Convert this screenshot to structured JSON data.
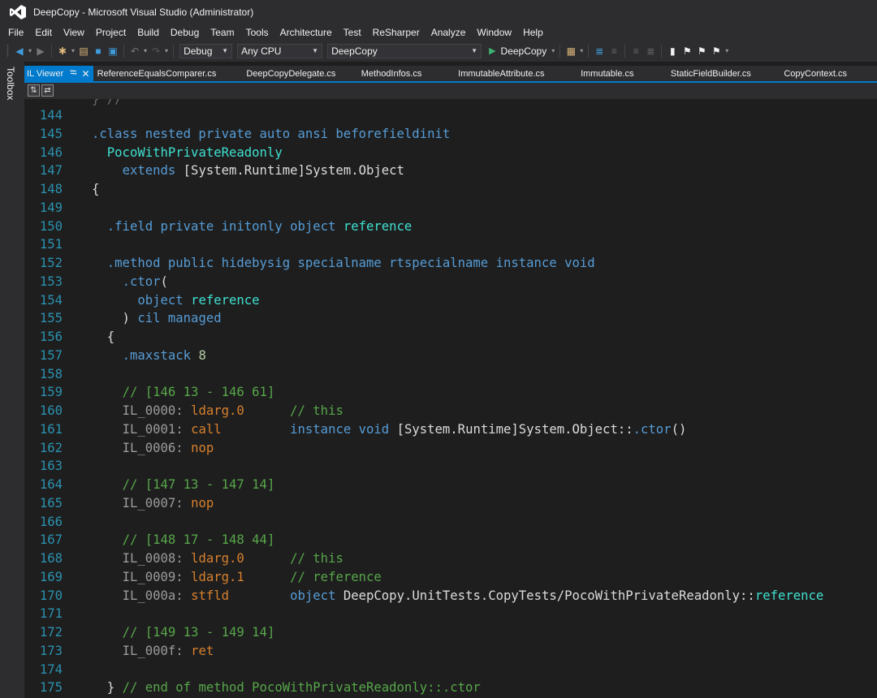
{
  "window": {
    "title": "DeepCopy - Microsoft Visual Studio  (Administrator)",
    "logo_icon": "visual-studio-logo"
  },
  "menu": [
    "File",
    "Edit",
    "View",
    "Project",
    "Build",
    "Debug",
    "Team",
    "Tools",
    "Architecture",
    "Test",
    "ReSharper",
    "Analyze",
    "Window",
    "Help"
  ],
  "toolbar": {
    "configuration": "Debug",
    "platform": "Any CPU",
    "startup_project": "DeepCopy",
    "run_label": "DeepCopy"
  },
  "toolbox_label": "Toolbox",
  "tabs": [
    {
      "label": "IL Viewer",
      "active": true
    },
    {
      "label": "ReferenceEqualsComparer.cs"
    },
    {
      "label": "DeepCopyDelegate.cs"
    },
    {
      "label": "MethodInfos.cs"
    },
    {
      "label": "ImmutableAttribute.cs"
    },
    {
      "label": "Immutable.cs"
    },
    {
      "label": "StaticFieldBuilder.cs"
    },
    {
      "label": "CopyContext.cs"
    }
  ],
  "code": {
    "lines": [
      {
        "n": "144"
      },
      {
        "n": "145",
        "t": ".class nested private auto ansi beforefieldinit"
      },
      {
        "n": "146",
        "t": "PocoWithPrivateReadonly"
      },
      {
        "n": "147",
        "t": "extends [System.Runtime]System.Object"
      },
      {
        "n": "148",
        "t": "{"
      },
      {
        "n": "149"
      },
      {
        "n": "150",
        "t": ".field private initonly object reference"
      },
      {
        "n": "151"
      },
      {
        "n": "152",
        "t": ".method public hidebysig specialname rtspecialname instance void"
      },
      {
        "n": "153",
        "t": ".ctor("
      },
      {
        "n": "154",
        "t": "object reference"
      },
      {
        "n": "155",
        "t": ") cil managed"
      },
      {
        "n": "156",
        "t": "{"
      },
      {
        "n": "157",
        "t": ".maxstack 8"
      },
      {
        "n": "158"
      },
      {
        "n": "159",
        "t": "// [146 13 - 146 61]"
      },
      {
        "n": "160",
        "t": "IL_0000: ldarg.0      // this"
      },
      {
        "n": "161",
        "t": "IL_0001: call         instance void [System.Runtime]System.Object::.ctor()"
      },
      {
        "n": "162",
        "t": "IL_0006: nop"
      },
      {
        "n": "163"
      },
      {
        "n": "164",
        "t": "// [147 13 - 147 14]"
      },
      {
        "n": "165",
        "t": "IL_0007: nop"
      },
      {
        "n": "166"
      },
      {
        "n": "167",
        "t": "// [148 17 - 148 44]"
      },
      {
        "n": "168",
        "t": "IL_0008: ldarg.0      // this"
      },
      {
        "n": "169",
        "t": "IL_0009: ldarg.1      // reference"
      },
      {
        "n": "170",
        "t": "IL_000a: stfld        object DeepCopy.UnitTests.CopyTests/PocoWithPrivateReadonly::reference"
      },
      {
        "n": "171"
      },
      {
        "n": "172",
        "t": "// [149 13 - 149 14]"
      },
      {
        "n": "173",
        "t": "IL_000f: ret"
      },
      {
        "n": "174"
      },
      {
        "n": "175",
        "t": "} // end of method PocoWithPrivateReadonly::.ctor"
      }
    ]
  },
  "colors": {
    "background": "#1e1e1e",
    "chrome": "#2d2d30",
    "accent": "#007acc",
    "line_number": "#2b91af",
    "keyword": "#569cd6",
    "type_name": "#4ec9b0",
    "opcode": "#d7802e",
    "comment": "#57a64a",
    "il_label": "#9b9b9b"
  }
}
